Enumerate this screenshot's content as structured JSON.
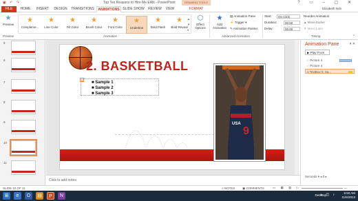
{
  "window": {
    "title": "Top Ten Reasons to Hire Me EAN - PowerPoint",
    "contextual_tab_group": "DRAWING TOOLS",
    "user": "Elizabeth Noh"
  },
  "tabs": [
    {
      "label": "FILE"
    },
    {
      "label": "HOME"
    },
    {
      "label": "INSERT"
    },
    {
      "label": "DESIGN"
    },
    {
      "label": "TRANSITIONS"
    },
    {
      "label": "ANIMATIONS"
    },
    {
      "label": "SLIDE SHOW"
    },
    {
      "label": "REVIEW"
    },
    {
      "label": "VIEW"
    },
    {
      "label": "FORMAT"
    }
  ],
  "ribbon": {
    "preview_label": "Preview",
    "preview_group": "Preview",
    "animation_group": "Animation",
    "gallery": [
      "Compleme...",
      "Line Color",
      "Fill Color",
      "Brush Color",
      "Font Color",
      "Underline",
      "Bold Flash",
      "Bold Reveal"
    ],
    "selected_effect": "Underline",
    "effect_options": "Effect Options",
    "add_animation": "Add Animation",
    "animation_pane": "Animation Pane",
    "trigger": "Trigger",
    "animation_painter": "Animation Painter",
    "advanced_group": "Advanced Animation",
    "start_label": "Start:",
    "start_value": "On Click",
    "duration_label": "Duration:",
    "duration_value": "00.50",
    "delay_label": "Delay:",
    "delay_value": "00.00",
    "reorder_label": "Reorder Animation",
    "move_earlier": "Move Earlier",
    "move_later": "Move Later",
    "timing_group": "Timing"
  },
  "thumbnails": [
    {
      "num": "5"
    },
    {
      "num": "6"
    },
    {
      "num": "7"
    },
    {
      "num": "8"
    },
    {
      "num": "9"
    },
    {
      "num": "10"
    },
    {
      "num": "11"
    }
  ],
  "slide": {
    "title": "2. BASKETBALL",
    "bullets": [
      "Sample 1",
      "Sample 2",
      "Sample 3"
    ],
    "anim_marker": "1"
  },
  "anim_pane": {
    "title": "Animation Pane",
    "play_from": "Play From",
    "items": [
      {
        "label": "Picture 4"
      },
      {
        "label": "Picture 4"
      },
      {
        "label": "1  TextBox 5: Sa..."
      }
    ],
    "seconds": "Seconds"
  },
  "notes": {
    "placeholder": "Click to add notes"
  },
  "status": {
    "slide_info": "SLIDE 10 OF 11",
    "notes": "NOTES",
    "comments": "COMMENTS",
    "zoom": "—"
  },
  "taskbar": {
    "desktop": "Desktop",
    "time": "6:50 AM",
    "date": "11/6/2013"
  },
  "colors": {
    "accent": "#c43e1c",
    "title_red": "#c0231a",
    "selection": "#f9d9bd"
  }
}
